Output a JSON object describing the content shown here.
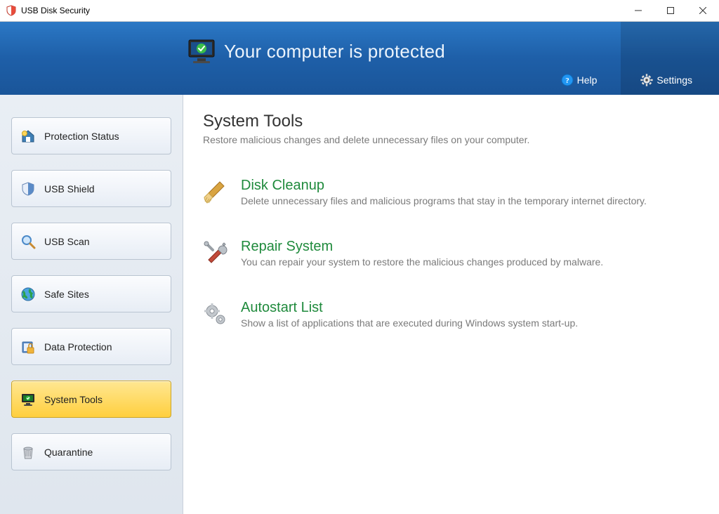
{
  "window": {
    "title": "USB Disk Security"
  },
  "banner": {
    "status": "Your computer is protected",
    "help_label": "Help",
    "settings_label": "Settings"
  },
  "sidebar": {
    "items": [
      {
        "label": "Protection Status",
        "icon": "home-shield-icon"
      },
      {
        "label": "USB Shield",
        "icon": "shield-icon"
      },
      {
        "label": "USB Scan",
        "icon": "magnifier-icon"
      },
      {
        "label": "Safe Sites",
        "icon": "globe-icon"
      },
      {
        "label": "Data Protection",
        "icon": "lock-file-icon"
      },
      {
        "label": "System Tools",
        "icon": "monitor-icon",
        "active": true
      },
      {
        "label": "Quarantine",
        "icon": "trash-icon"
      }
    ]
  },
  "main": {
    "title": "System Tools",
    "subtitle": "Restore malicious changes and delete unnecessary files on your computer.",
    "tools": [
      {
        "title": "Disk Cleanup",
        "desc": "Delete unnecessary files and malicious programs that stay in the temporary internet directory.",
        "icon": "broom-icon"
      },
      {
        "title": "Repair System",
        "desc": "You can repair your system to restore the malicious changes produced by malware.",
        "icon": "tools-icon"
      },
      {
        "title": "Autostart List",
        "desc": "Show a list of applications that are executed during Windows system start-up.",
        "icon": "gears-icon"
      }
    ]
  }
}
